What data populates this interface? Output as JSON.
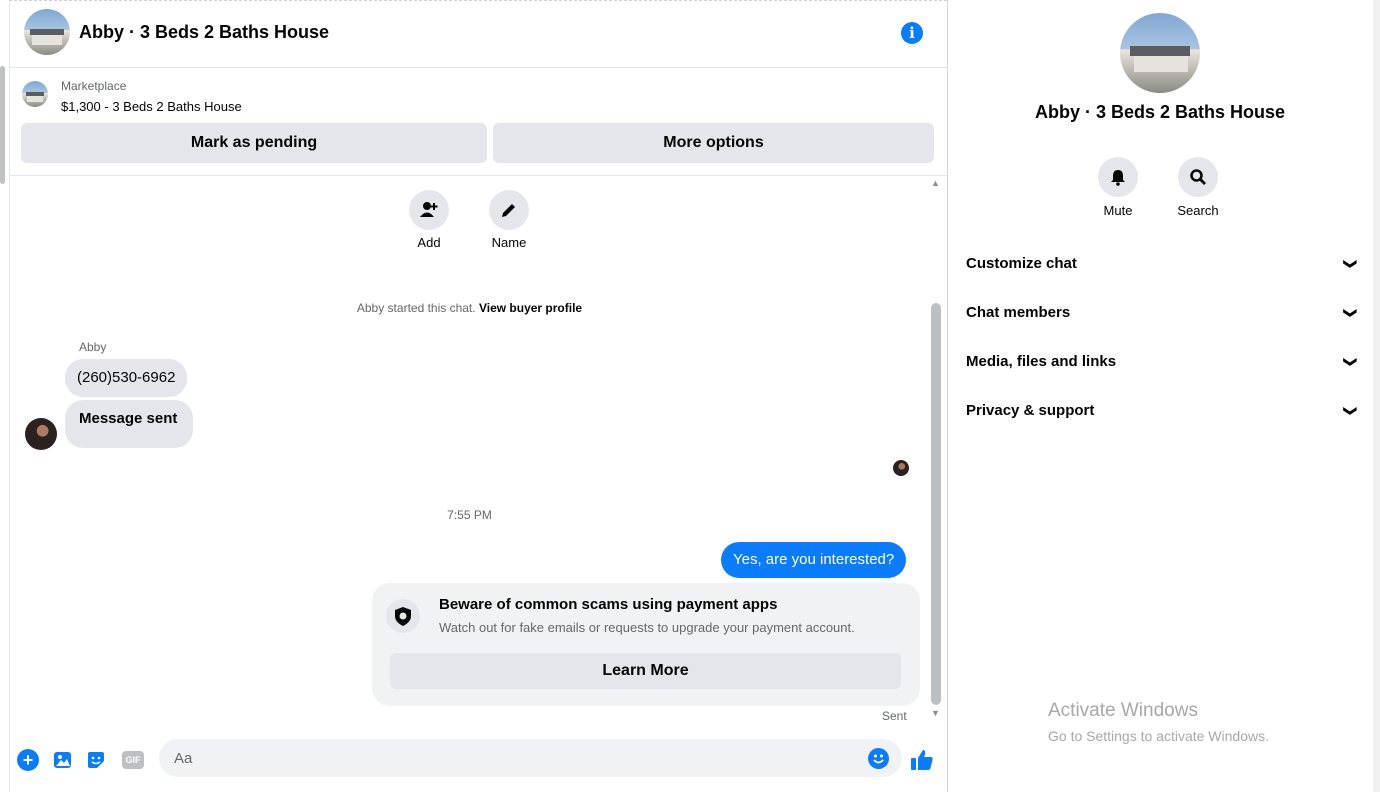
{
  "header": {
    "title": "Abby · 3 Beds 2 Baths House"
  },
  "marketplace": {
    "label": "Marketplace",
    "listing": "$1,300 - 3 Beds 2 Baths House",
    "mark_pending_label": "Mark as pending",
    "more_options_label": "More options"
  },
  "quick_actions": {
    "add_label": "Add",
    "name_label": "Name"
  },
  "chat": {
    "started_text": "Abby started this chat.",
    "view_profile_label": "View buyer profile",
    "sender_name": "Abby",
    "incoming": [
      "(260)530-6962",
      "Message sent"
    ],
    "timestamp": "7:55 PM",
    "outgoing": "Yes, are you interested?",
    "scam_card": {
      "title": "Beware of common scams using payment apps",
      "body": "Watch out for fake emails or requests to upgrade your payment account.",
      "button_label": "Learn More"
    },
    "status": "Sent"
  },
  "composer": {
    "placeholder": "Aa",
    "gif_label": "GIF"
  },
  "sidebar": {
    "title": "Abby · 3 Beds 2 Baths House",
    "mute_label": "Mute",
    "search_label": "Search",
    "sections": [
      {
        "label": "Customize chat"
      },
      {
        "label": "Chat members"
      },
      {
        "label": "Media, files and links"
      },
      {
        "label": "Privacy & support"
      }
    ]
  },
  "watermark": {
    "line1": "Activate Windows",
    "line2": "Go to Settings to activate Windows."
  },
  "colors": {
    "accent": "#0a7cff",
    "bubble_gray": "#e4e6eb"
  }
}
